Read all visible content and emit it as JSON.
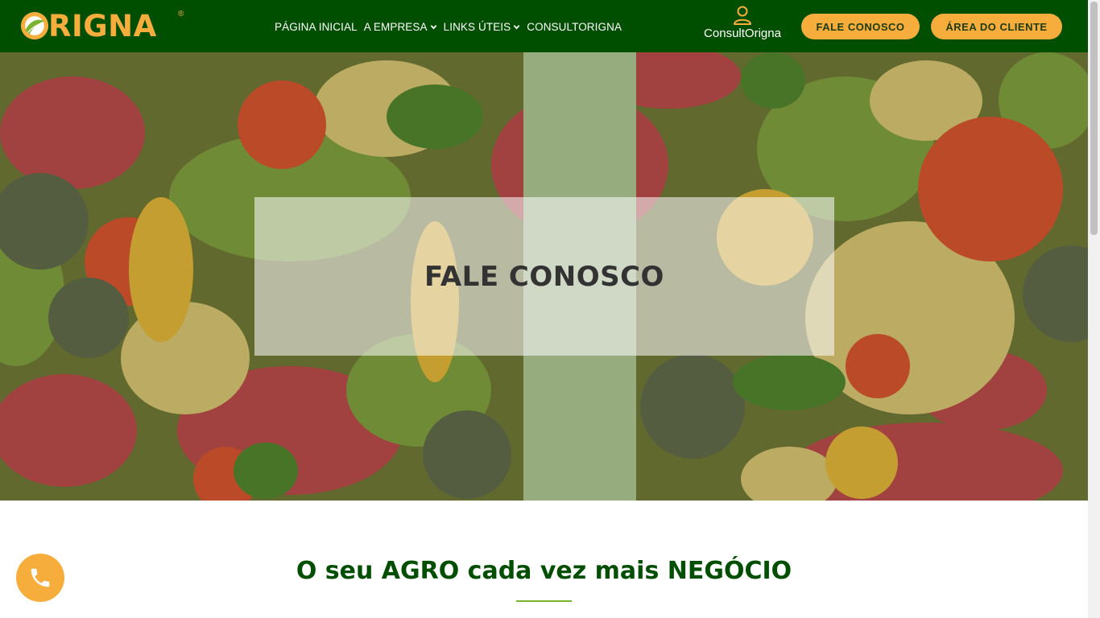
{
  "header": {
    "logo_text": "RIGNA",
    "logo_registered": "®",
    "nav": [
      {
        "label": "PÁGINA INICIAL",
        "has_dropdown": false
      },
      {
        "label": "A EMPRESA",
        "has_dropdown": true
      },
      {
        "label": "LINKS ÚTEIS",
        "has_dropdown": true
      },
      {
        "label": "CONSULTORIGNA",
        "has_dropdown": false
      }
    ],
    "consult_label": "ConsultOrigna",
    "contact_button": "FALE CONOSCO",
    "client_button": "ÁREA DO CLIENTE"
  },
  "hero": {
    "title": "FALE CONOSCO",
    "background": "vegetables-photo"
  },
  "section": {
    "title": "O seu AGRO cada vez mais NEGÓCIO"
  },
  "icons": {
    "user": "user-icon",
    "chevron": "chevron-down-icon",
    "phone": "phone-icon",
    "logo": "sun-leaf-logo-icon"
  },
  "colors": {
    "header_bg": "#004e00",
    "accent": "#f6ad3c",
    "heading_green": "#004e00",
    "rule_green": "#7bb32e"
  }
}
